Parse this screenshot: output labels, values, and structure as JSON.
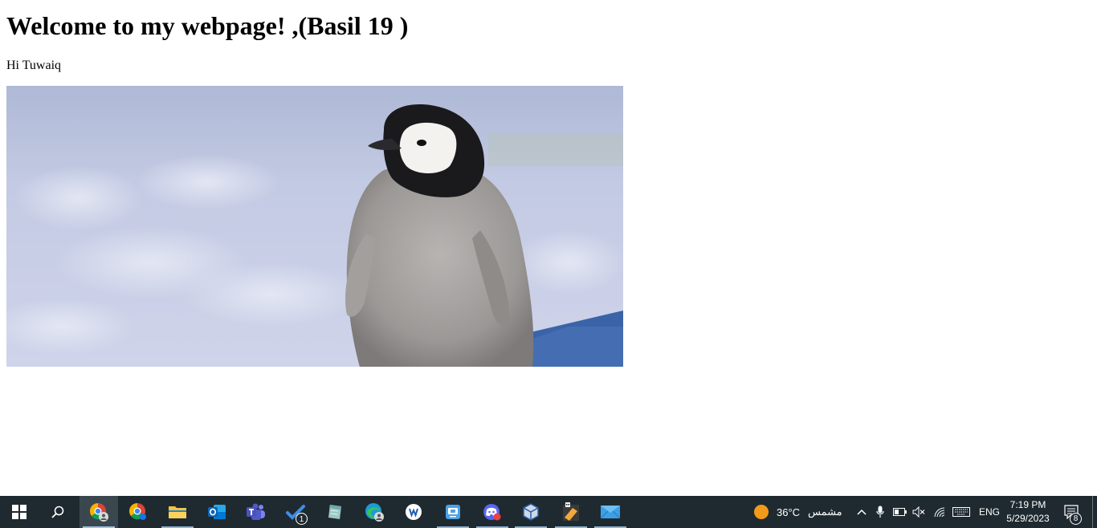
{
  "page": {
    "heading": "Welcome to my webpage! ,(Basil 19 )",
    "paragraph": "Hi Tuwaiq",
    "image_subject": "emperor-penguin-chick-on-snow"
  },
  "taskbar": {
    "apps": [
      {
        "name": "windows-start-icon"
      },
      {
        "name": "search-icon"
      },
      {
        "name": "chrome-profile-icon",
        "active": true
      },
      {
        "name": "chrome-icon"
      },
      {
        "name": "file-explorer-icon"
      },
      {
        "name": "outlook-icon"
      },
      {
        "name": "teams-icon"
      },
      {
        "name": "todo-icon",
        "badge": "1"
      },
      {
        "name": "notes-icon"
      },
      {
        "name": "edge-profile-icon"
      },
      {
        "name": "app-w-icon"
      },
      {
        "name": "remote-desktop-icon"
      },
      {
        "name": "discord-icon"
      },
      {
        "name": "virtualbox-icon"
      },
      {
        "name": "game-app-icon"
      },
      {
        "name": "mail-icon"
      }
    ],
    "weather": {
      "temperature": "36°C",
      "condition": "مشمس",
      "icon": "sun-icon"
    },
    "tray": {
      "language": "ENG",
      "time": "7:19 PM",
      "date": "5/29/2023",
      "notifications_count": "8"
    },
    "colors": {
      "background": "#1f2a30",
      "active": "#3b474e",
      "indicator": "#8fb4d8"
    }
  }
}
